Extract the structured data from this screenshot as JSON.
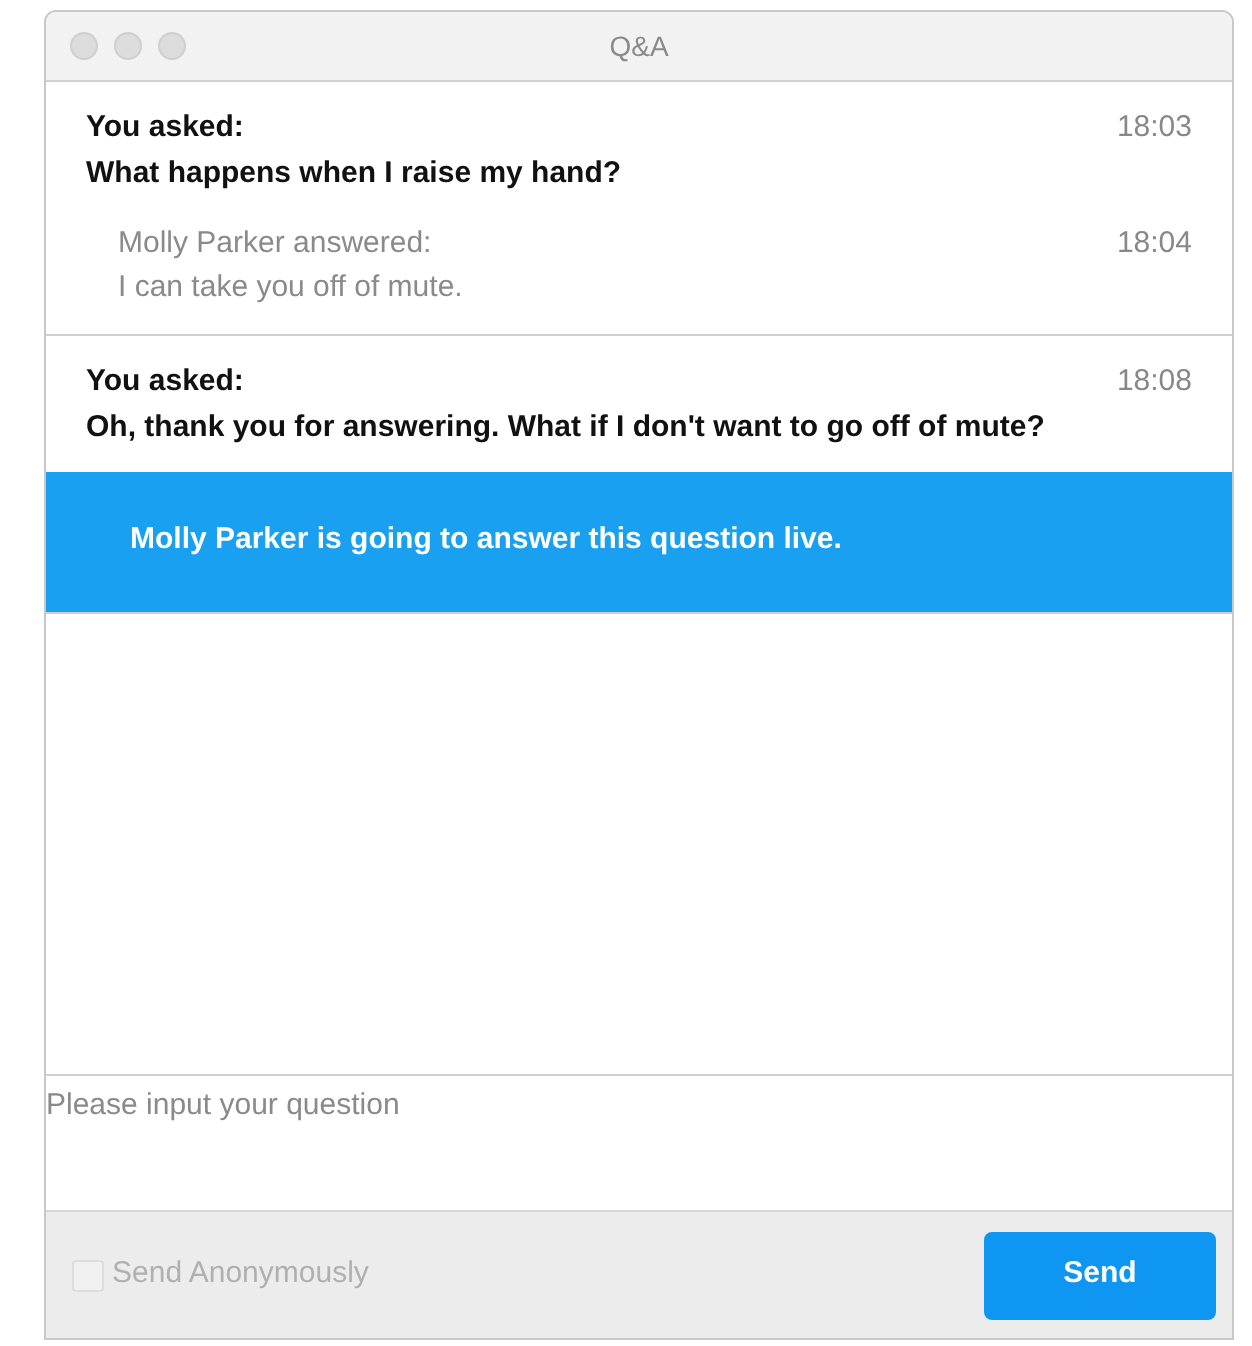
{
  "window": {
    "title": "Q&A"
  },
  "questions": [
    {
      "asker": "You asked:",
      "time": "18:03",
      "text": "What happens when I raise my hand?",
      "answers": [
        {
          "kind": "text",
          "author": "Molly Parker answered:",
          "time": "18:04",
          "text": "I can take you off of mute."
        }
      ]
    },
    {
      "asker": "You asked:",
      "time": "18:08",
      "text": "Oh, thank you for answering. What if I don't want to go off of mute?",
      "answers": [
        {
          "kind": "live",
          "text": "Molly Parker is going to answer this question live."
        }
      ]
    }
  ],
  "input": {
    "placeholder": "Please input your question"
  },
  "anonymous": {
    "label": "Send Anonymously",
    "checked": false,
    "disabled": true
  },
  "send_button": "Send"
}
